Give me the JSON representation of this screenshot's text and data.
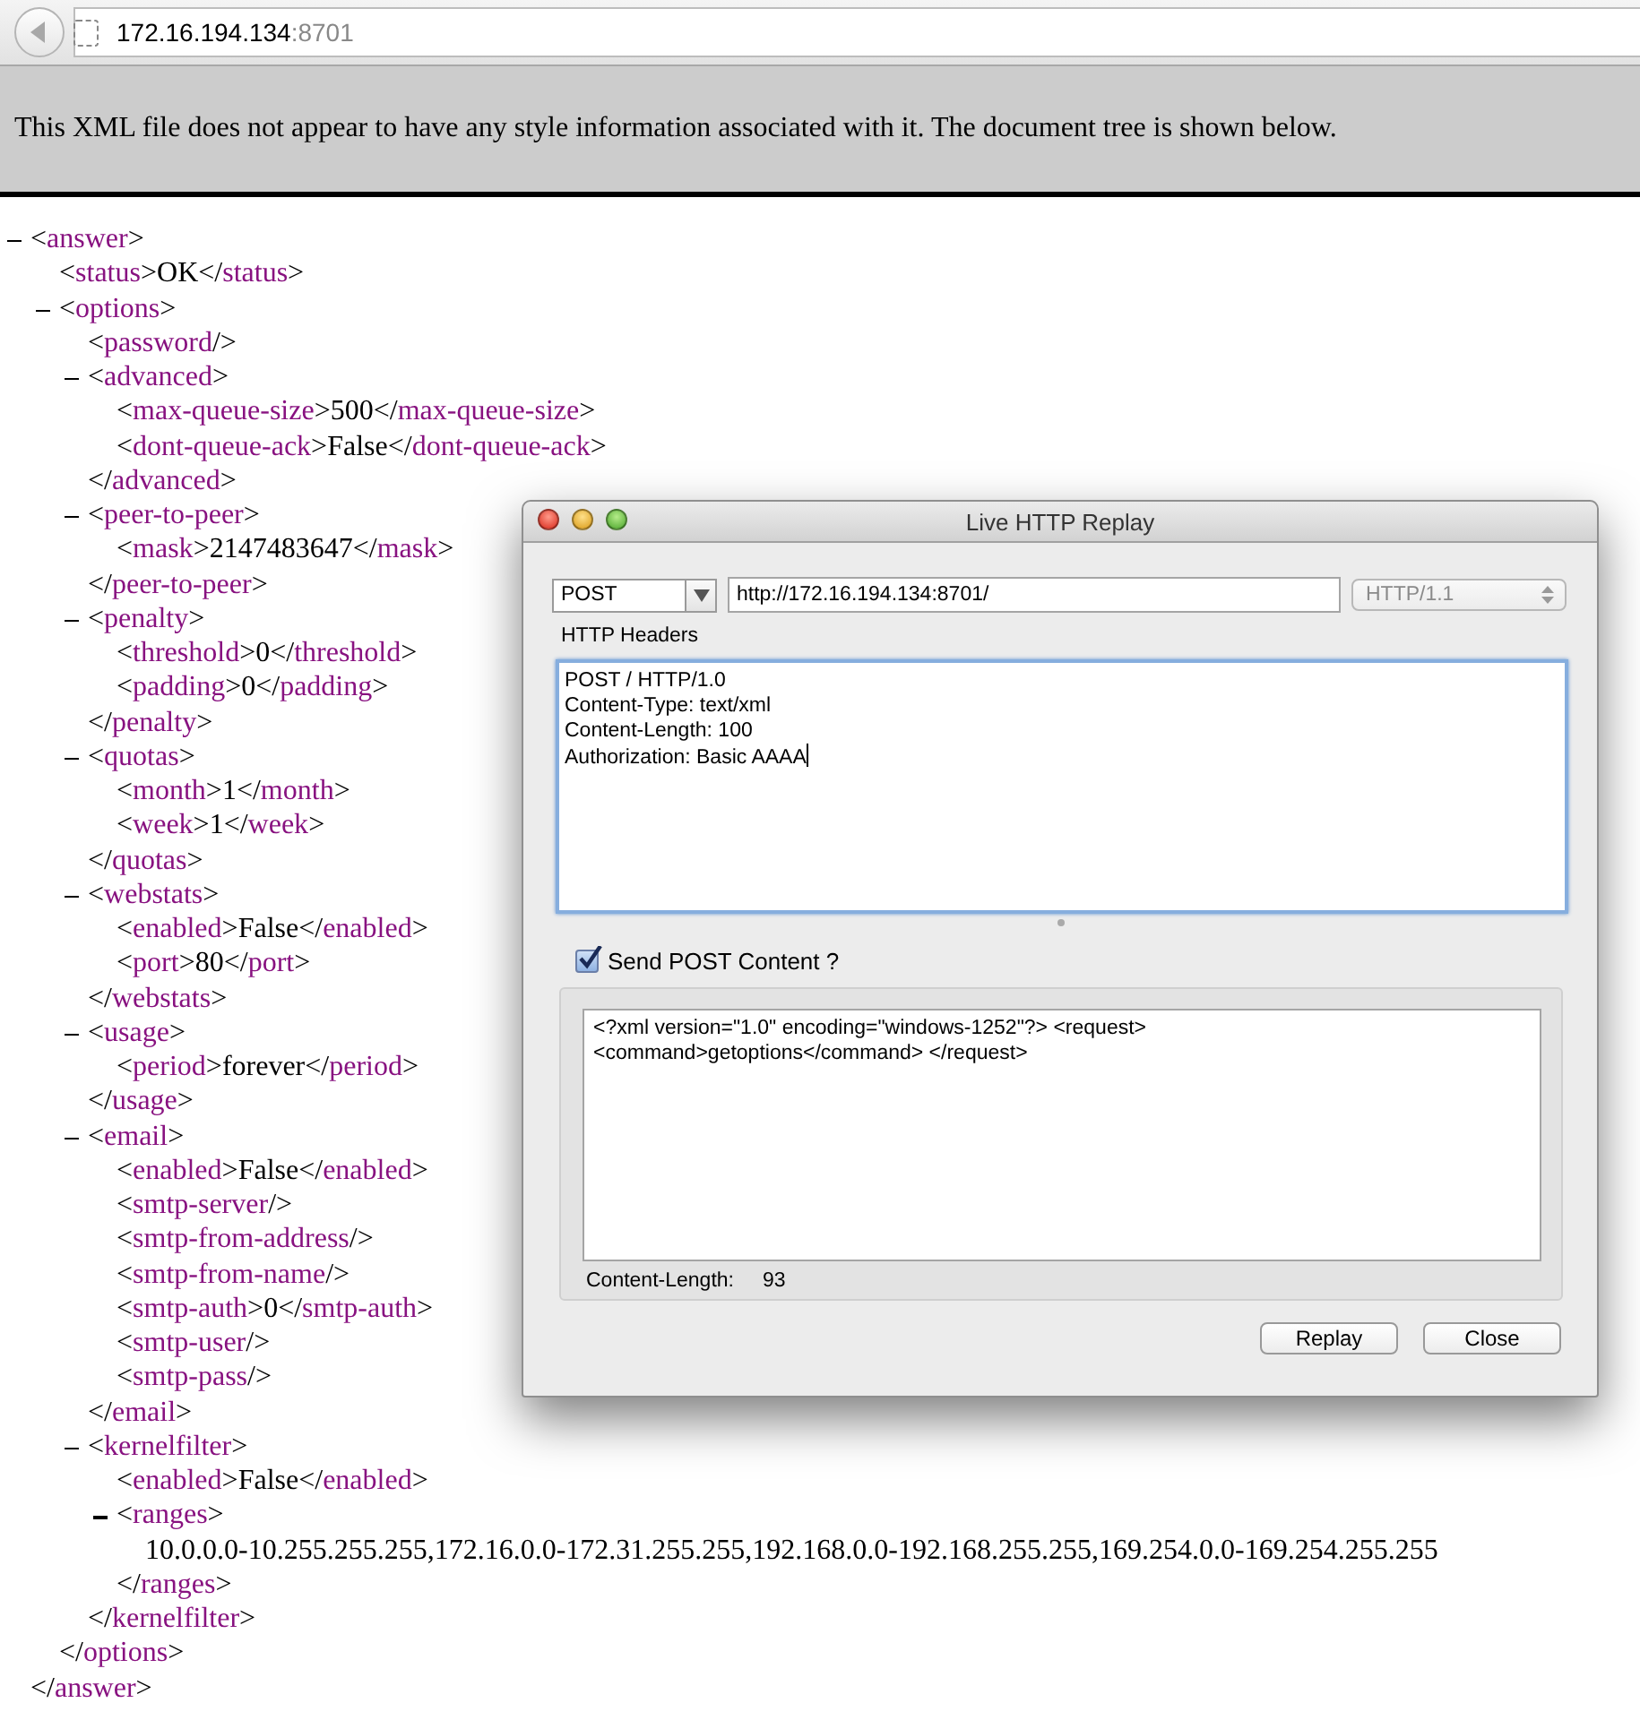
{
  "browser": {
    "address_host": "172.16.194.134",
    "address_port": ":8701"
  },
  "notice": "This XML file does not appear to have any style information associated with it. The document tree is shown below.",
  "xml_tree": {
    "kind": "parent",
    "open": "<answer>",
    "close": "</answer>",
    "expanded": true,
    "children": [
      {
        "kind": "leaf",
        "open": "<status>",
        "text": "OK",
        "close": "</status>"
      },
      {
        "kind": "parent",
        "open": "<options>",
        "close": "</options>",
        "expanded": true,
        "children": [
          {
            "kind": "empty",
            "open": "<password/>"
          },
          {
            "kind": "parent",
            "open": "<advanced>",
            "close": "</advanced>",
            "expanded": true,
            "children": [
              {
                "kind": "leaf",
                "open": "<max-queue-size>",
                "text": "500",
                "close": "</max-queue-size>"
              },
              {
                "kind": "leaf",
                "open": "<dont-queue-ack>",
                "text": "False",
                "close": "</dont-queue-ack>"
              }
            ]
          },
          {
            "kind": "parent",
            "open": "<peer-to-peer>",
            "close": "</peer-to-peer>",
            "expanded": true,
            "children": [
              {
                "kind": "leaf",
                "open": "<mask>",
                "text": "2147483647",
                "close": "</mask>"
              }
            ]
          },
          {
            "kind": "parent",
            "open": "<penalty>",
            "close": "</penalty>",
            "expanded": true,
            "children": [
              {
                "kind": "leaf",
                "open": "<threshold>",
                "text": "0",
                "close": "</threshold>"
              },
              {
                "kind": "leaf",
                "open": "<padding>",
                "text": "0",
                "close": "</padding>"
              }
            ]
          },
          {
            "kind": "parent",
            "open": "<quotas>",
            "close": "</quotas>",
            "expanded": true,
            "children": [
              {
                "kind": "leaf",
                "open": "<month>",
                "text": "1",
                "close": "</month>"
              },
              {
                "kind": "leaf",
                "open": "<week>",
                "text": "1",
                "close": "</week>"
              }
            ]
          },
          {
            "kind": "parent",
            "open": "<webstats>",
            "close": "</webstats>",
            "expanded": true,
            "children": [
              {
                "kind": "leaf",
                "open": "<enabled>",
                "text": "False",
                "close": "</enabled>"
              },
              {
                "kind": "leaf",
                "open": "<port>",
                "text": "80",
                "close": "</port>"
              }
            ]
          },
          {
            "kind": "parent",
            "open": "<usage>",
            "close": "</usage>",
            "expanded": true,
            "children": [
              {
                "kind": "leaf",
                "open": "<period>",
                "text": "forever",
                "close": "</period>"
              }
            ]
          },
          {
            "kind": "parent",
            "open": "<email>",
            "close": "</email>",
            "expanded": true,
            "children": [
              {
                "kind": "leaf",
                "open": "<enabled>",
                "text": "False",
                "close": "</enabled>"
              },
              {
                "kind": "empty",
                "open": "<smtp-server/>"
              },
              {
                "kind": "empty",
                "open": "<smtp-from-address/>"
              },
              {
                "kind": "empty",
                "open": "<smtp-from-name/>"
              },
              {
                "kind": "leaf",
                "open": "<smtp-auth>",
                "text": "0",
                "close": "</smtp-auth>"
              },
              {
                "kind": "empty",
                "open": "<smtp-user/>"
              },
              {
                "kind": "empty",
                "open": "<smtp-pass/>"
              }
            ]
          },
          {
            "kind": "parent",
            "open": "<kernelfilter>",
            "close": "</kernelfilter>",
            "expanded": true,
            "children": [
              {
                "kind": "leaf",
                "open": "<enabled>",
                "text": "False",
                "close": "</enabled>"
              },
              {
                "kind": "block",
                "open": "<ranges>",
                "text": "10.0.0.0-10.255.255.255,172.16.0.0-172.31.255.255,192.168.0.0-192.168.255.255,169.254.0.0-169.254.255.255",
                "close": "</ranges>",
                "expanded": true
              }
            ]
          }
        ]
      }
    ]
  },
  "dialog": {
    "title": "Live HTTP Replay",
    "method": "POST",
    "url": "http://172.16.194.134:8701/",
    "version": {
      "value": "HTTP/1.1",
      "disabled": true
    },
    "headers_label": "HTTP Headers",
    "headers": [
      "POST / HTTP/1.0",
      "Content-Type: text/xml",
      "Content-Length: 100",
      "Authorization: Basic AAAA"
    ],
    "send_post": {
      "label": "Send POST Content ?",
      "checked": true
    },
    "post_content": [
      "<?xml version=\"1.0\" encoding=\"windows-1252\"?> <request>",
      "<command>getoptions</command> </request>"
    ],
    "content_length_label": "Content-Length:",
    "content_length": "93",
    "buttons": [
      "Replay",
      "Close"
    ]
  }
}
